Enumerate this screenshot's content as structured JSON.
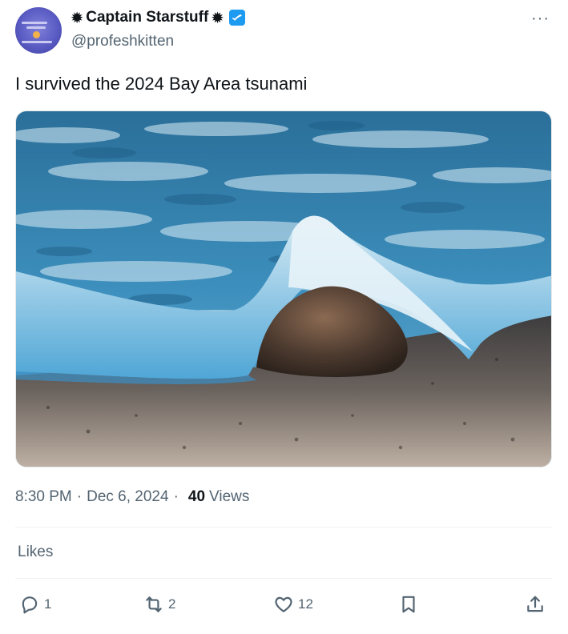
{
  "header": {
    "name": "Captain Starstuff",
    "decoration_left": "✹",
    "decoration_right": "✹",
    "handle": "@profeshkitten",
    "more_label": "···",
    "accent_color": "#1d9bf0"
  },
  "tweet": {
    "text": "I survived the 2024 Bay Area tsunami",
    "image_icon": "photo-wave-over-rock"
  },
  "meta": {
    "time": "8:30 PM",
    "separator": "·",
    "date": "Dec 6, 2024",
    "views_count": "40",
    "views_label": "Views"
  },
  "likes_label": "Likes",
  "actions": {
    "reply_count": "1",
    "retweet_count": "2",
    "like_count": "12"
  }
}
